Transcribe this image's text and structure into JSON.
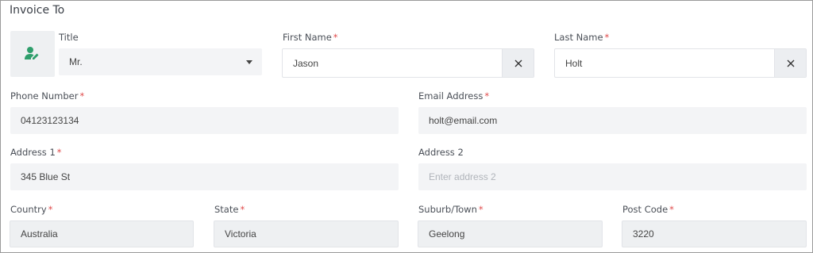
{
  "section": {
    "title": "Invoice To"
  },
  "accent_color": "#2e9e6b",
  "required_color": "#e04b4b",
  "icons": {
    "avatar": "user-edit-icon",
    "clear": "close-icon",
    "dropdown": "caret-down-icon"
  },
  "fields": {
    "title": {
      "label": "Title",
      "value": "Mr."
    },
    "first_name": {
      "label": "First Name",
      "required": "*",
      "value": "Jason"
    },
    "last_name": {
      "label": "Last Name",
      "required": "*",
      "value": "Holt"
    },
    "phone": {
      "label": "Phone Number",
      "required": "*",
      "value": "04123123134"
    },
    "email": {
      "label": "Email Address",
      "required": "*",
      "value": "holt@email.com"
    },
    "address1": {
      "label": "Address 1",
      "required": "*",
      "value": "345 Blue St"
    },
    "address2": {
      "label": "Address 2",
      "placeholder": "Enter address 2"
    },
    "country": {
      "label": "Country",
      "required": "*",
      "value": "Australia"
    },
    "state": {
      "label": "State",
      "required": "*",
      "value": "Victoria"
    },
    "suburb": {
      "label": "Suburb/Town",
      "required": "*",
      "value": "Geelong"
    },
    "postcode": {
      "label": "Post Code",
      "required": "*",
      "value": "3220"
    }
  }
}
